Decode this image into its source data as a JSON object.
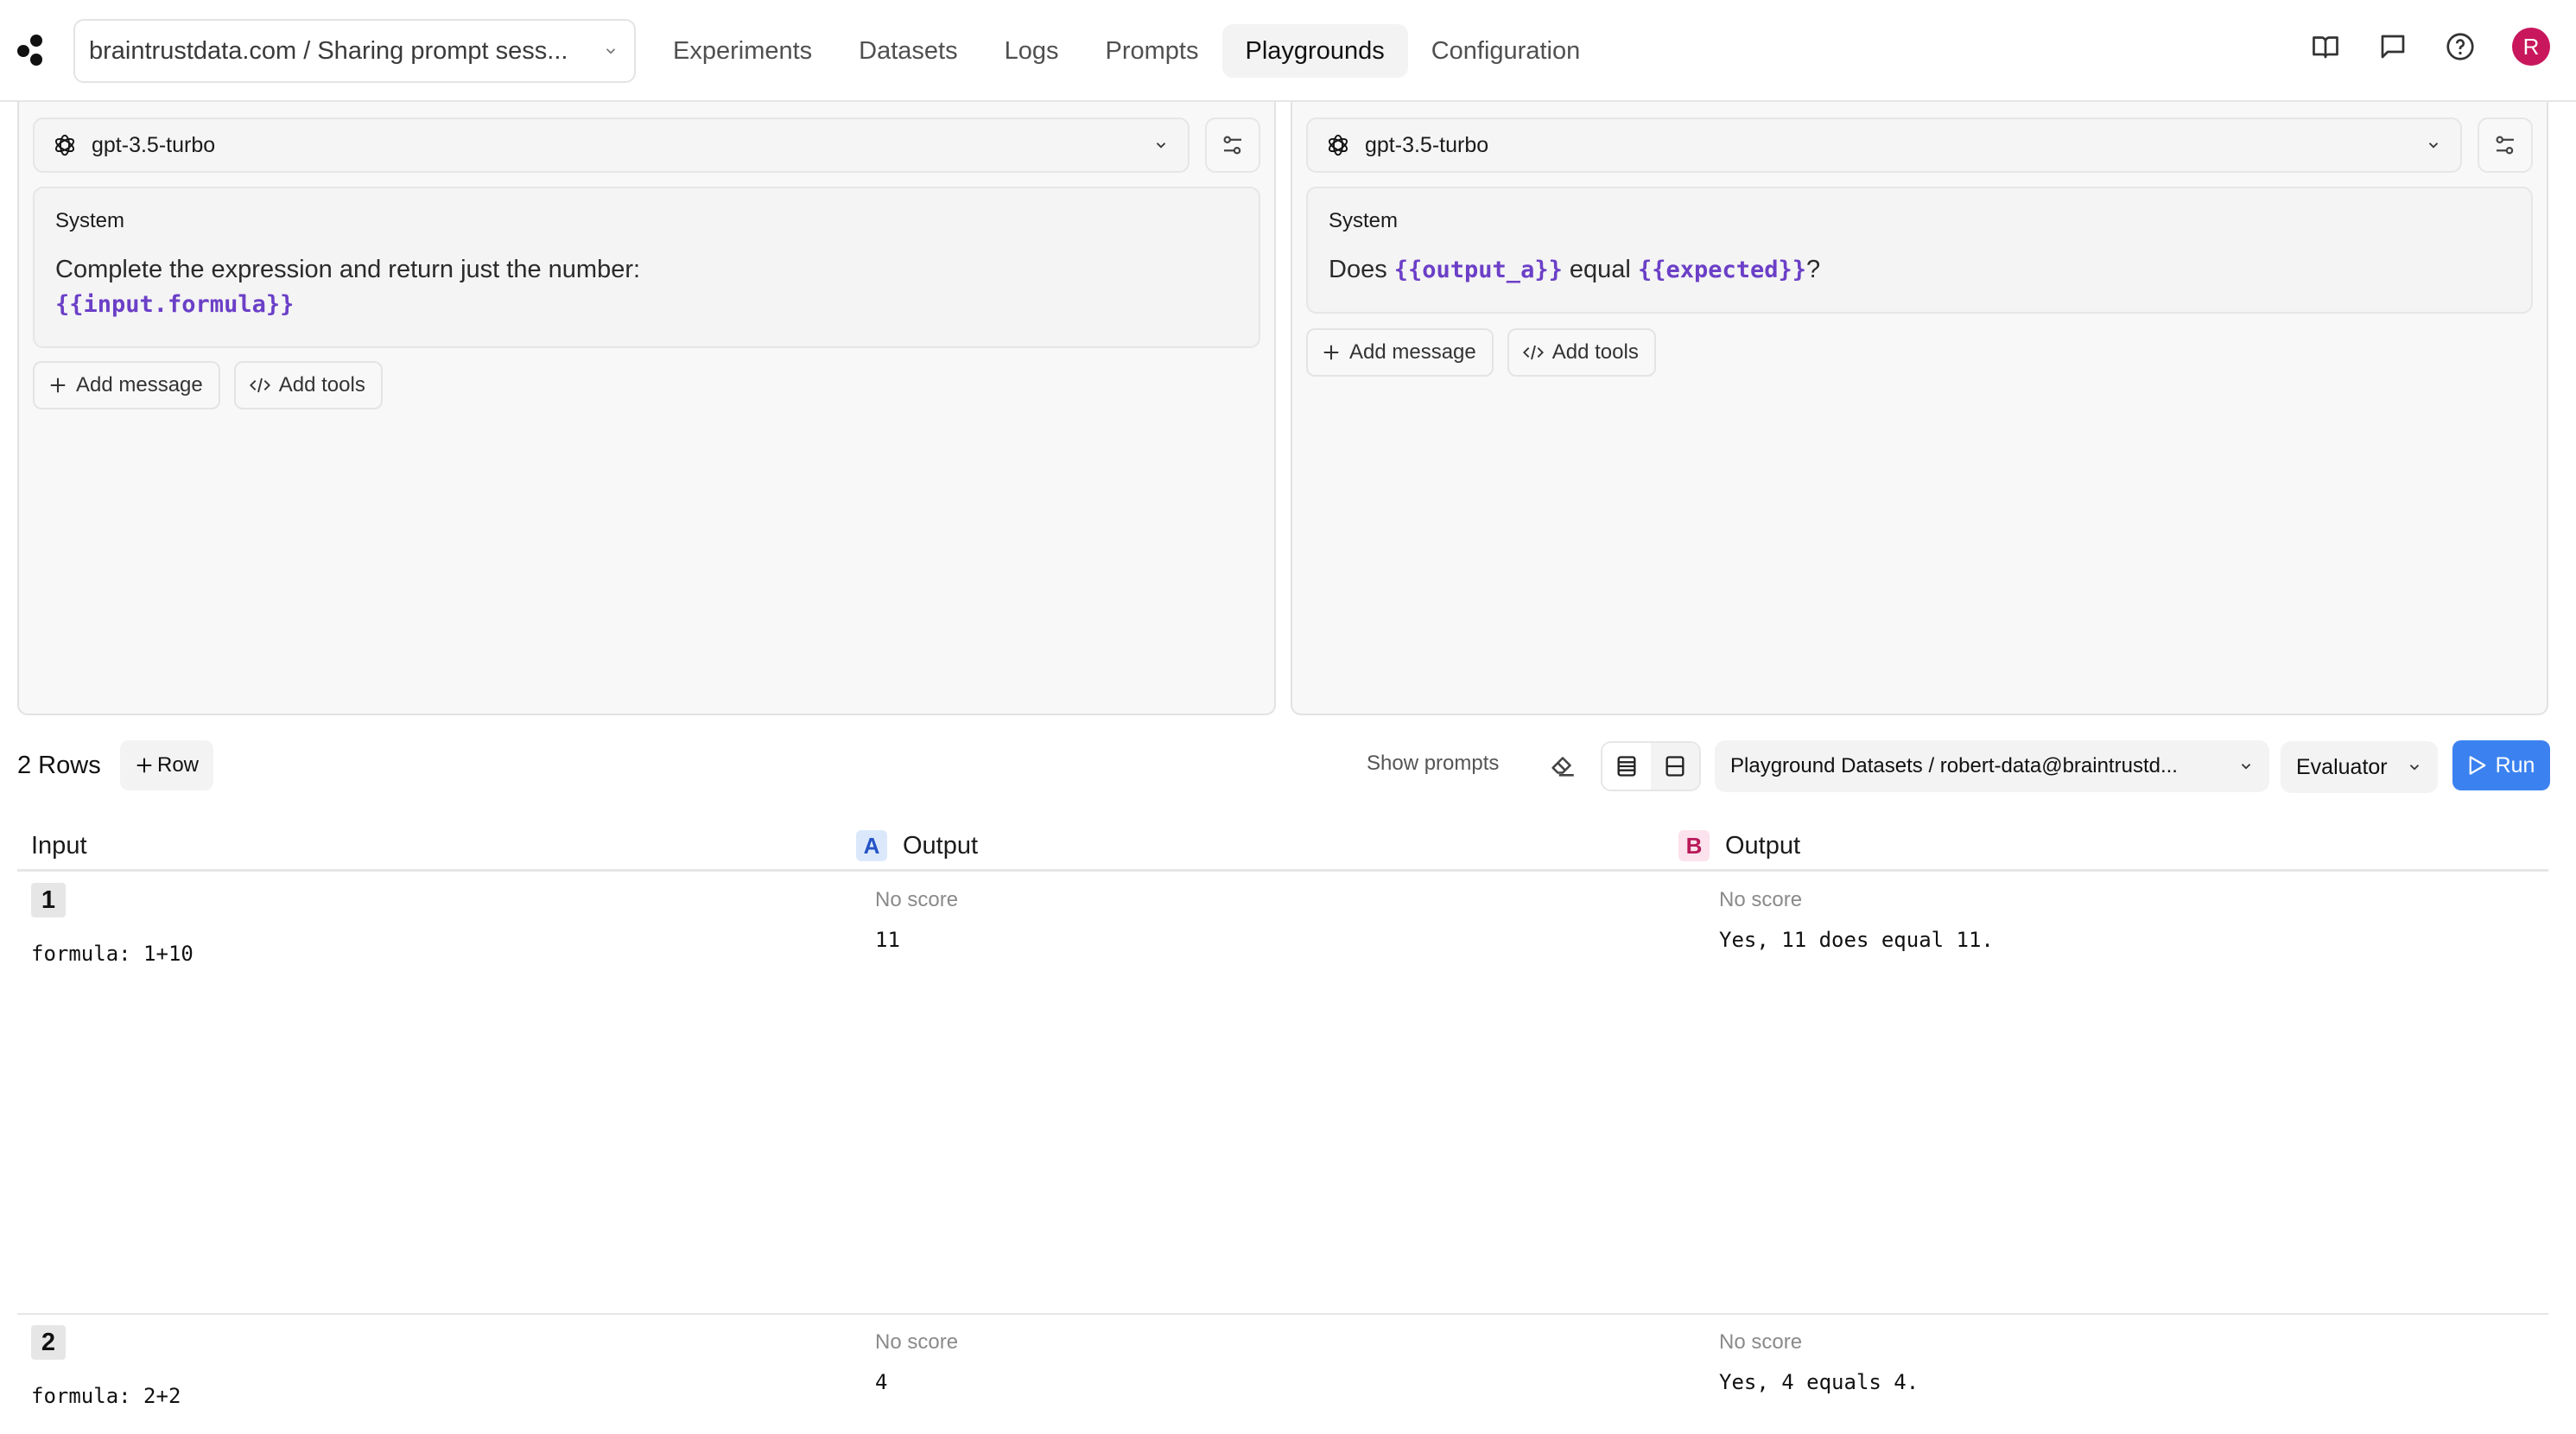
{
  "header": {
    "project_selector": "braintrustdata.com / Sharing prompt sess...",
    "nav": [
      {
        "label": "Experiments",
        "active": false
      },
      {
        "label": "Datasets",
        "active": false
      },
      {
        "label": "Prompts",
        "active": false
      },
      {
        "label": "Logs",
        "active": false
      },
      {
        "label": "Playgrounds",
        "active": true
      },
      {
        "label": "Configuration",
        "active": false
      }
    ],
    "nav_order": [
      "Experiments",
      "Datasets",
      "Logs",
      "Prompts",
      "Playgrounds",
      "Configuration"
    ],
    "icons": [
      "book-icon",
      "chat-icon",
      "help-icon"
    ],
    "avatar_initial": "R",
    "avatar_color": "#c8175d"
  },
  "prompts": [
    {
      "id": "A",
      "model": "gpt-3.5-turbo",
      "message_role": "System",
      "message_text_before": "Complete the expression and return just the number:",
      "message_var_1": "{{input.formula}}",
      "add_message_label": "Add message",
      "add_tools_label": "Add tools"
    },
    {
      "id": "B",
      "model": "gpt-3.5-turbo",
      "message_role": "System",
      "message_text_before": "Does",
      "message_var_1": "{{output_a}}",
      "message_text_middle": "equal",
      "message_var_2": "{{expected}}",
      "message_text_after": "?",
      "add_message_label": "Add message",
      "add_tools_label": "Add tools"
    }
  ],
  "toolbar": {
    "rows_count": "2 Rows",
    "add_row_label": "Row",
    "show_prompts_label": "Show prompts",
    "dataset_select": "Playground Datasets / robert-data@braintrustd...",
    "evaluator_select": "Evaluator",
    "run_label": "Run",
    "run_color": "#3b82f0"
  },
  "table": {
    "columns": [
      {
        "label": "Input",
        "badge": null
      },
      {
        "label": "Output",
        "badge": "A"
      },
      {
        "label": "Output",
        "badge": "B"
      }
    ],
    "rows": [
      {
        "num": "1",
        "input": "formula: 1+10",
        "a_score": "No score",
        "a_output": "11",
        "b_score": "No score",
        "b_output": "Yes, 11 does equal 11."
      },
      {
        "num": "2",
        "input": "formula: 2+2",
        "a_score": "No score",
        "a_output": "4",
        "b_score": "No score",
        "b_output": "Yes, 4 equals 4."
      }
    ]
  }
}
